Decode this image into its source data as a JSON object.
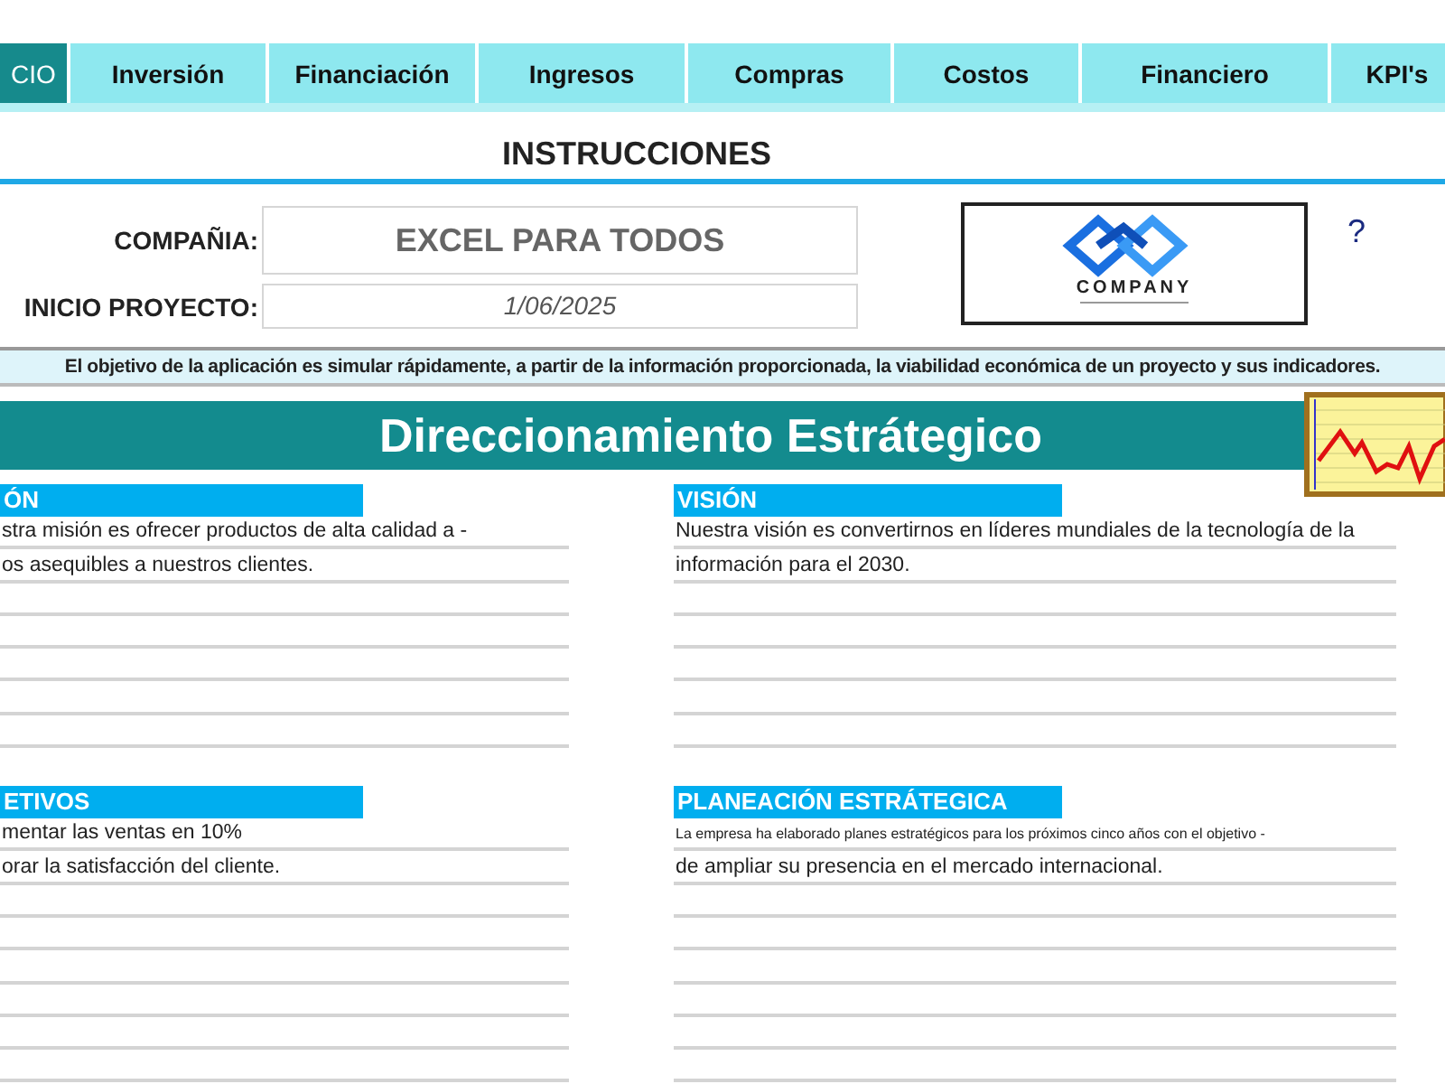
{
  "tabs": [
    {
      "label": "CIO",
      "selected": true
    },
    {
      "label": "Inversión",
      "selected": false
    },
    {
      "label": "Financiación",
      "selected": false
    },
    {
      "label": "Ingresos",
      "selected": false
    },
    {
      "label": "Compras",
      "selected": false
    },
    {
      "label": "Costos",
      "selected": false
    },
    {
      "label": "Financiero",
      "selected": false
    },
    {
      "label": "KPI's",
      "selected": false
    }
  ],
  "title": "INSTRUCCIONES",
  "company": {
    "label": "COMPAÑIA:",
    "value": "EXCEL PARA TODOS"
  },
  "start": {
    "label": "INICIO PROYECTO:",
    "value": "1/06/2025"
  },
  "logo": {
    "text": "COMPANY"
  },
  "help": "?",
  "objective": "El objetivo de la aplicación es simular rápidamente, a partir de la información proporcionada, la viabilidad económica de un proyecto y sus indicadores.",
  "banner": "Direccionamiento Estrátegico",
  "sections": [
    {
      "heading": "ÓN",
      "lines": [
        {
          "kind": "body",
          "text": "stra misión es ofrecer productos de alta calidad a -"
        },
        {
          "kind": "body",
          "text": "os asequibles a nuestros clientes."
        }
      ]
    },
    {
      "heading": "VISIÓN",
      "lines": [
        {
          "kind": "body",
          "text": "Nuestra visión es convertirnos en líderes mundiales de la tecnología de la"
        },
        {
          "kind": "body",
          "text": "información para el 2030."
        }
      ]
    },
    {
      "heading": "ETIVOS",
      "lines": [
        {
          "kind": "body",
          "text": "mentar las ventas en 10%"
        },
        {
          "kind": "body",
          "text": "orar la satisfacción del cliente."
        }
      ]
    },
    {
      "heading": "PLANEACIÓN ESTRÁTEGICA",
      "lines": [
        {
          "kind": "note",
          "text": "La empresa ha elaborado planes estratégicos para los próximos cinco años con el objetivo -"
        },
        {
          "kind": "body",
          "text": "de ampliar su presencia en el mercado internacional."
        }
      ]
    }
  ]
}
